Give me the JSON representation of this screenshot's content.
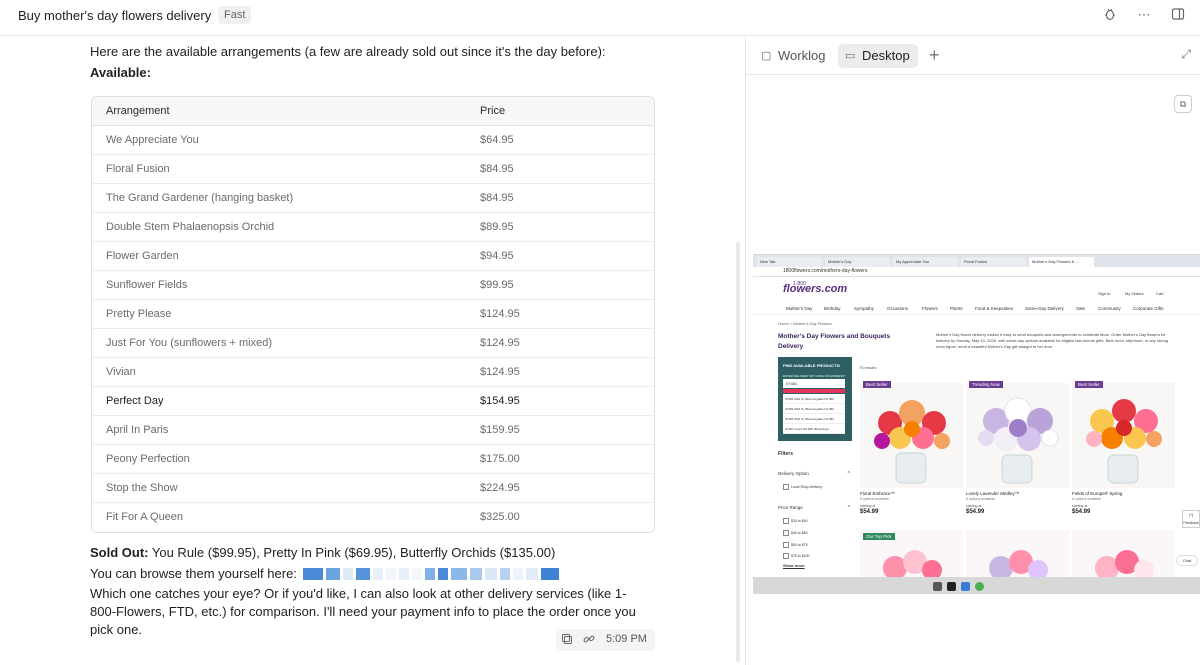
{
  "header": {
    "title": "Buy mother's day flowers delivery",
    "badge": "Fast"
  },
  "chat": {
    "intro": "Here are the available arrangements (a few are already sold out since it's the day before):",
    "available_label": "Available:",
    "table": {
      "columns": [
        "Arrangement",
        "Price"
      ],
      "rows": [
        {
          "name": "We Appreciate You",
          "price": "$64.95"
        },
        {
          "name": "Floral Fusion",
          "price": "$84.95"
        },
        {
          "name": "The Grand Gardener (hanging basket)",
          "price": "$84.95"
        },
        {
          "name": "Double Stem Phalaenopsis Orchid",
          "price": "$89.95"
        },
        {
          "name": "Flower Garden",
          "price": "$94.95"
        },
        {
          "name": "Sunflower Fields",
          "price": "$99.95"
        },
        {
          "name": "Pretty Please",
          "price": "$124.95"
        },
        {
          "name": "Just For You (sunflowers + mixed)",
          "price": "$124.95"
        },
        {
          "name": "Vivian",
          "price": "$124.95"
        },
        {
          "name": "Perfect Day",
          "price": "$154.95"
        },
        {
          "name": "April In Paris",
          "price": "$159.95"
        },
        {
          "name": "Peony Perfection",
          "price": "$175.00"
        },
        {
          "name": "Stop the Show",
          "price": "$224.95"
        },
        {
          "name": "Fit For A Queen",
          "price": "$325.00"
        }
      ]
    },
    "sold_out_label": "Sold Out:",
    "sold_out_text": " You Rule ($99.95), Pretty In Pink ($69.95), Butterfly Orchids ($135.00)",
    "browse_text": "You can browse them yourself here:",
    "followup": "Which one catches your eye? Or if you'd like, I can also look at other delivery services (like 1-800-Flowers, FTD, etc.) for comparison. I'll need your payment info to place the order once you pick one.",
    "timestamp": "5:09 PM"
  },
  "side": {
    "tabs": [
      {
        "label": "Worklog",
        "active": false
      },
      {
        "label": "Desktop",
        "active": true
      }
    ]
  },
  "browser": {
    "tabs": [
      "New Tab",
      "Mother's Day",
      "My Appreciate You",
      "Floral Fusion",
      "Mother's Day Flowers & ..."
    ],
    "url": "1800flowers.com/mothers-day-flowers",
    "logo_top": "1-800",
    "logo": "flowers.com",
    "account": [
      "Sign In",
      "My Orders",
      "Cart"
    ],
    "nav": [
      "Mother's Day",
      "Birthday",
      "Sympathy",
      "Occasions",
      "Flowers",
      "Plants",
      "Food & Keepsakes",
      "Same-Day Delivery",
      "Sale",
      "Community",
      "Corporate Gifts"
    ],
    "breadcrumb": "Home > Mother's Day Flowers",
    "heading": "Mother's Day Flowers and Bouquets Delivery",
    "intro": "Mother's Day flower delivery makes it easy to send bouquets and arrangements to celebrate Mom. Order Mother's Day flowers for delivery by Sunday, May 10, 2026, with same-day options available for eligible last-minute gifts. Birth mom, stepmom, or any strong mom figure, send a beautiful Mother's Day gift straight to her door.",
    "finder_title": "FIND AVAILABLE PRODUCTS!",
    "finder_sub": "ENTER DELIVERY ZIP CODE OR ADDRESS*",
    "finder_input": "07481",
    "finder_options": [
      "07481 Wild St, Bloomingdale NJ 080",
      "07481 Wild St, Bloomingdale NJ 080",
      "07481 Wild St, Bloomingdale NJ 080",
      "07481 Count Rd 385, Bloomingd"
    ],
    "results": "78 results",
    "filters_label": "Filters",
    "delivery_option": "Delivery Option",
    "local_shop": "Local Shop Delivery",
    "price_range": "Price Range",
    "price_options": [
      "$30 to $40",
      "$40 to $50",
      "$50 to $75",
      "$75 to $100"
    ],
    "show_more": "Show more",
    "cards": [
      {
        "tag": "Best Seller",
        "name": "Floral Embrace™",
        "options": "8 options available",
        "from": "starting at",
        "price": "$54.99"
      },
      {
        "tag": "Trending Now",
        "name": "Lovely Lavender Medley™",
        "options": "8 options available",
        "from": "starting at",
        "price": "$54.99"
      },
      {
        "tag": "Best Seller",
        "name": "Fields of Europe® Spring",
        "options": "8 options available",
        "from": "starting at",
        "price": "$54.99"
      }
    ],
    "row2_tag": "Our Top Pick",
    "chat_label": "Chat",
    "feedback": "[+] Feedback"
  },
  "colors": {
    "brand_purple": "#5a2d82",
    "finder_teal": "#2d5f63",
    "finder_red": "#e2375a",
    "link_mask": "#4a8ad6"
  }
}
